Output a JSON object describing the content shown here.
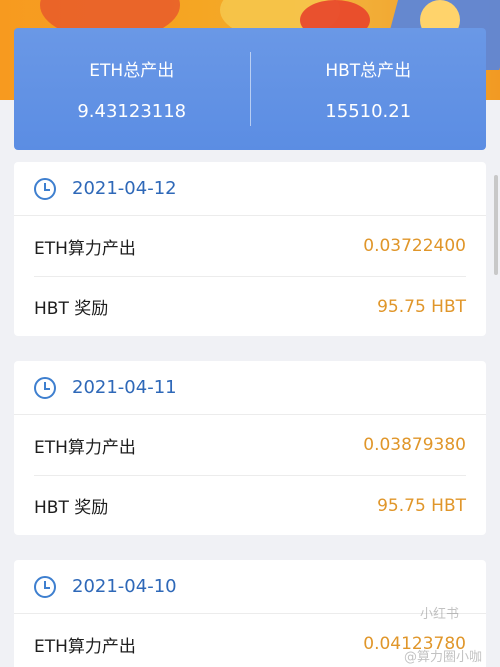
{
  "summary": {
    "eth_label": "ETH总产出",
    "eth_value": "9.43123118",
    "hbt_label": "HBT总产出",
    "hbt_value": "15510.21"
  },
  "records": [
    {
      "date": "2021-04-12",
      "eth_label": "ETH算力产出",
      "eth_value": "0.03722400",
      "hbt_label": "HBT 奖励",
      "hbt_value": "95.75 HBT"
    },
    {
      "date": "2021-04-11",
      "eth_label": "ETH算力产出",
      "eth_value": "0.03879380",
      "hbt_label": "HBT 奖励",
      "hbt_value": "95.75 HBT"
    },
    {
      "date": "2021-04-10",
      "eth_label": "ETH算力产出",
      "eth_value": "0.04123780"
    }
  ],
  "watermark": {
    "badge": "小红书",
    "handle": "@算力圈小咖"
  },
  "colors": {
    "accent": "#5b8de3",
    "date_text": "#2e68b8",
    "value_text": "#e0962a"
  }
}
